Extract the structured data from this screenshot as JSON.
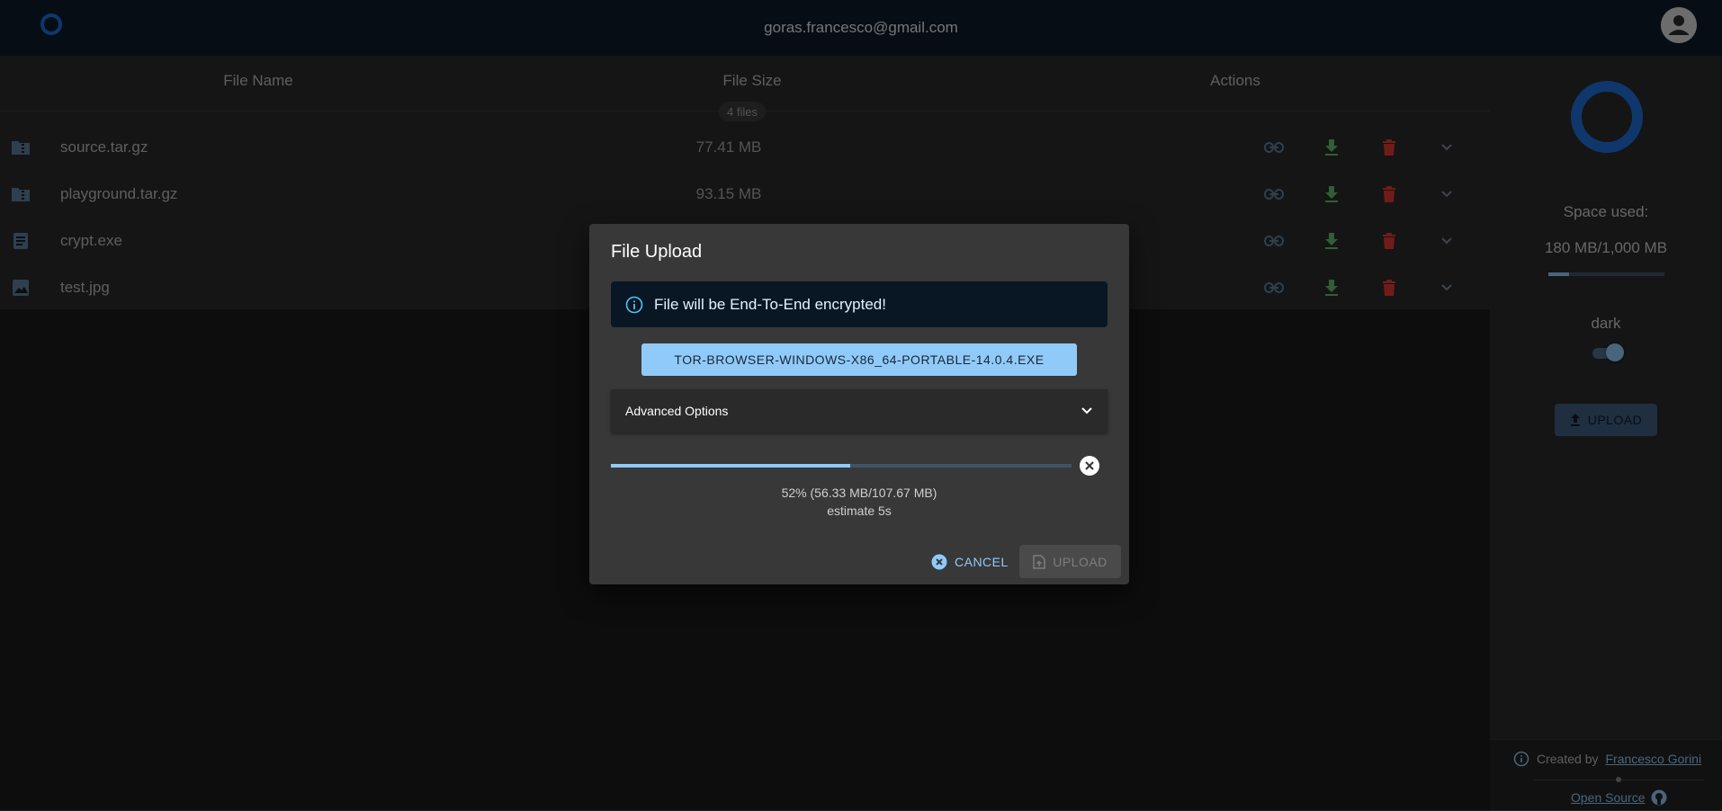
{
  "header": {
    "email": "goras.francesco@gmail.com",
    "logo_icon": "app-logo-icon",
    "account_icon": "account-circle-icon"
  },
  "table": {
    "columns": [
      "File Name",
      "File Size",
      "Actions"
    ],
    "files_badge": "4 files",
    "rows": [
      {
        "name": "source.tar.gz",
        "size": "77.41 MB",
        "icon": "folder-zip-icon"
      },
      {
        "name": "playground.tar.gz",
        "size": "93.15 MB",
        "icon": "folder-zip-icon"
      },
      {
        "name": "crypt.exe",
        "size": "",
        "icon": "document-icon"
      },
      {
        "name": "test.jpg",
        "size": "",
        "icon": "image-icon"
      }
    ],
    "action_icons": [
      "link-icon",
      "download-icon",
      "delete-icon",
      "expand-icon"
    ]
  },
  "sidebar": {
    "space_label": "Space used:",
    "space_value": "180 MB/1,000 MB",
    "space_fraction": 0.18,
    "theme_label": "dark",
    "theme_dark_on": true,
    "upload_label": "UPLOAD",
    "footer": {
      "created_by": "Created by",
      "author": "Francesco Gorini",
      "open_source": "Open Source"
    }
  },
  "dialog": {
    "title": "File Upload",
    "alert_text": "File will be End-To-End encrypted!",
    "file_button": "TOR-BROWSER-WINDOWS-X86_64-PORTABLE-14.0.4.EXE",
    "advanced_options": "Advanced Options",
    "progress_percent": 52,
    "progress_text": "52% (56.33 MB/107.67 MB)",
    "estimate_text": "estimate 5s",
    "cancel_label": "CANCEL",
    "upload_label": "UPLOAD"
  },
  "colors": {
    "accent": "#90caf9",
    "header_bg": "#0d1a2b",
    "download": "#66bb6a",
    "delete": "#e53935"
  }
}
